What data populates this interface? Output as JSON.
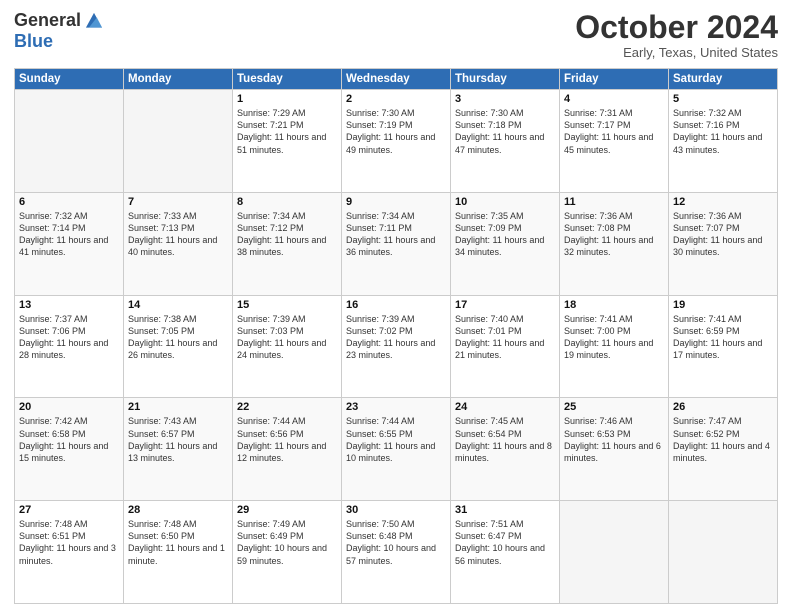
{
  "header": {
    "logo_general": "General",
    "logo_blue": "Blue",
    "month_title": "October 2024",
    "location": "Early, Texas, United States"
  },
  "weekdays": [
    "Sunday",
    "Monday",
    "Tuesday",
    "Wednesday",
    "Thursday",
    "Friday",
    "Saturday"
  ],
  "weeks": [
    [
      {
        "day": "",
        "sunrise": "",
        "sunset": "",
        "daylight": "",
        "empty": true
      },
      {
        "day": "",
        "sunrise": "",
        "sunset": "",
        "daylight": "",
        "empty": true
      },
      {
        "day": "1",
        "sunrise": "Sunrise: 7:29 AM",
        "sunset": "Sunset: 7:21 PM",
        "daylight": "Daylight: 11 hours and 51 minutes."
      },
      {
        "day": "2",
        "sunrise": "Sunrise: 7:30 AM",
        "sunset": "Sunset: 7:19 PM",
        "daylight": "Daylight: 11 hours and 49 minutes."
      },
      {
        "day": "3",
        "sunrise": "Sunrise: 7:30 AM",
        "sunset": "Sunset: 7:18 PM",
        "daylight": "Daylight: 11 hours and 47 minutes."
      },
      {
        "day": "4",
        "sunrise": "Sunrise: 7:31 AM",
        "sunset": "Sunset: 7:17 PM",
        "daylight": "Daylight: 11 hours and 45 minutes."
      },
      {
        "day": "5",
        "sunrise": "Sunrise: 7:32 AM",
        "sunset": "Sunset: 7:16 PM",
        "daylight": "Daylight: 11 hours and 43 minutes."
      }
    ],
    [
      {
        "day": "6",
        "sunrise": "Sunrise: 7:32 AM",
        "sunset": "Sunset: 7:14 PM",
        "daylight": "Daylight: 11 hours and 41 minutes."
      },
      {
        "day": "7",
        "sunrise": "Sunrise: 7:33 AM",
        "sunset": "Sunset: 7:13 PM",
        "daylight": "Daylight: 11 hours and 40 minutes."
      },
      {
        "day": "8",
        "sunrise": "Sunrise: 7:34 AM",
        "sunset": "Sunset: 7:12 PM",
        "daylight": "Daylight: 11 hours and 38 minutes."
      },
      {
        "day": "9",
        "sunrise": "Sunrise: 7:34 AM",
        "sunset": "Sunset: 7:11 PM",
        "daylight": "Daylight: 11 hours and 36 minutes."
      },
      {
        "day": "10",
        "sunrise": "Sunrise: 7:35 AM",
        "sunset": "Sunset: 7:09 PM",
        "daylight": "Daylight: 11 hours and 34 minutes."
      },
      {
        "day": "11",
        "sunrise": "Sunrise: 7:36 AM",
        "sunset": "Sunset: 7:08 PM",
        "daylight": "Daylight: 11 hours and 32 minutes."
      },
      {
        "day": "12",
        "sunrise": "Sunrise: 7:36 AM",
        "sunset": "Sunset: 7:07 PM",
        "daylight": "Daylight: 11 hours and 30 minutes."
      }
    ],
    [
      {
        "day": "13",
        "sunrise": "Sunrise: 7:37 AM",
        "sunset": "Sunset: 7:06 PM",
        "daylight": "Daylight: 11 hours and 28 minutes."
      },
      {
        "day": "14",
        "sunrise": "Sunrise: 7:38 AM",
        "sunset": "Sunset: 7:05 PM",
        "daylight": "Daylight: 11 hours and 26 minutes."
      },
      {
        "day": "15",
        "sunrise": "Sunrise: 7:39 AM",
        "sunset": "Sunset: 7:03 PM",
        "daylight": "Daylight: 11 hours and 24 minutes."
      },
      {
        "day": "16",
        "sunrise": "Sunrise: 7:39 AM",
        "sunset": "Sunset: 7:02 PM",
        "daylight": "Daylight: 11 hours and 23 minutes."
      },
      {
        "day": "17",
        "sunrise": "Sunrise: 7:40 AM",
        "sunset": "Sunset: 7:01 PM",
        "daylight": "Daylight: 11 hours and 21 minutes."
      },
      {
        "day": "18",
        "sunrise": "Sunrise: 7:41 AM",
        "sunset": "Sunset: 7:00 PM",
        "daylight": "Daylight: 11 hours and 19 minutes."
      },
      {
        "day": "19",
        "sunrise": "Sunrise: 7:41 AM",
        "sunset": "Sunset: 6:59 PM",
        "daylight": "Daylight: 11 hours and 17 minutes."
      }
    ],
    [
      {
        "day": "20",
        "sunrise": "Sunrise: 7:42 AM",
        "sunset": "Sunset: 6:58 PM",
        "daylight": "Daylight: 11 hours and 15 minutes."
      },
      {
        "day": "21",
        "sunrise": "Sunrise: 7:43 AM",
        "sunset": "Sunset: 6:57 PM",
        "daylight": "Daylight: 11 hours and 13 minutes."
      },
      {
        "day": "22",
        "sunrise": "Sunrise: 7:44 AM",
        "sunset": "Sunset: 6:56 PM",
        "daylight": "Daylight: 11 hours and 12 minutes."
      },
      {
        "day": "23",
        "sunrise": "Sunrise: 7:44 AM",
        "sunset": "Sunset: 6:55 PM",
        "daylight": "Daylight: 11 hours and 10 minutes."
      },
      {
        "day": "24",
        "sunrise": "Sunrise: 7:45 AM",
        "sunset": "Sunset: 6:54 PM",
        "daylight": "Daylight: 11 hours and 8 minutes."
      },
      {
        "day": "25",
        "sunrise": "Sunrise: 7:46 AM",
        "sunset": "Sunset: 6:53 PM",
        "daylight": "Daylight: 11 hours and 6 minutes."
      },
      {
        "day": "26",
        "sunrise": "Sunrise: 7:47 AM",
        "sunset": "Sunset: 6:52 PM",
        "daylight": "Daylight: 11 hours and 4 minutes."
      }
    ],
    [
      {
        "day": "27",
        "sunrise": "Sunrise: 7:48 AM",
        "sunset": "Sunset: 6:51 PM",
        "daylight": "Daylight: 11 hours and 3 minutes."
      },
      {
        "day": "28",
        "sunrise": "Sunrise: 7:48 AM",
        "sunset": "Sunset: 6:50 PM",
        "daylight": "Daylight: 11 hours and 1 minute."
      },
      {
        "day": "29",
        "sunrise": "Sunrise: 7:49 AM",
        "sunset": "Sunset: 6:49 PM",
        "daylight": "Daylight: 10 hours and 59 minutes."
      },
      {
        "day": "30",
        "sunrise": "Sunrise: 7:50 AM",
        "sunset": "Sunset: 6:48 PM",
        "daylight": "Daylight: 10 hours and 57 minutes."
      },
      {
        "day": "31",
        "sunrise": "Sunrise: 7:51 AM",
        "sunset": "Sunset: 6:47 PM",
        "daylight": "Daylight: 10 hours and 56 minutes."
      },
      {
        "day": "",
        "sunrise": "",
        "sunset": "",
        "daylight": "",
        "empty": true
      },
      {
        "day": "",
        "sunrise": "",
        "sunset": "",
        "daylight": "",
        "empty": true
      }
    ]
  ]
}
